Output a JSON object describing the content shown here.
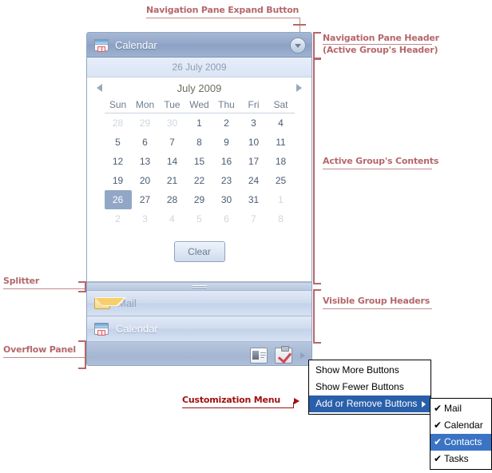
{
  "annotations": {
    "nav_expand_button": "Navigation Pane Expand Button",
    "nav_pane_header_line1": "Navigation Pane Header",
    "nav_pane_header_line2": "(Active Group's Header)",
    "active_group_contents": "Active Group's Contents",
    "visible_group_headers": "Visible Group Headers",
    "splitter": "Splitter",
    "overflow_panel": "Overflow Panel",
    "customization_menu": "Customization Menu",
    "accent_color": "#b5676b",
    "accent_color_dark": "#a01010"
  },
  "navpane": {
    "header": {
      "title": "Calendar",
      "icon": "calendar-icon",
      "expand_icon": "chevron-down-icon"
    },
    "calendar": {
      "selected_date_label": "26 July 2009",
      "month_label": "July 2009",
      "prev_icon": "triangle-left-icon",
      "next_icon": "triangle-right-icon",
      "weekday_headers": [
        "Sun",
        "Mon",
        "Tue",
        "Wed",
        "Thu",
        "Fri",
        "Sat"
      ],
      "weeks": [
        [
          {
            "d": "28",
            "s": "out"
          },
          {
            "d": "29",
            "s": "out"
          },
          {
            "d": "30",
            "s": "out"
          },
          {
            "d": "1",
            "s": ""
          },
          {
            "d": "2",
            "s": ""
          },
          {
            "d": "3",
            "s": ""
          },
          {
            "d": "4",
            "s": ""
          }
        ],
        [
          {
            "d": "5",
            "s": ""
          },
          {
            "d": "6",
            "s": ""
          },
          {
            "d": "7",
            "s": ""
          },
          {
            "d": "8",
            "s": ""
          },
          {
            "d": "9",
            "s": ""
          },
          {
            "d": "10",
            "s": ""
          },
          {
            "d": "11",
            "s": ""
          }
        ],
        [
          {
            "d": "12",
            "s": ""
          },
          {
            "d": "13",
            "s": ""
          },
          {
            "d": "14",
            "s": ""
          },
          {
            "d": "15",
            "s": ""
          },
          {
            "d": "16",
            "s": ""
          },
          {
            "d": "17",
            "s": ""
          },
          {
            "d": "18",
            "s": ""
          }
        ],
        [
          {
            "d": "19",
            "s": ""
          },
          {
            "d": "20",
            "s": ""
          },
          {
            "d": "21",
            "s": ""
          },
          {
            "d": "22",
            "s": ""
          },
          {
            "d": "23",
            "s": ""
          },
          {
            "d": "24",
            "s": ""
          },
          {
            "d": "25",
            "s": ""
          }
        ],
        [
          {
            "d": "26",
            "s": "sel"
          },
          {
            "d": "27",
            "s": ""
          },
          {
            "d": "28",
            "s": ""
          },
          {
            "d": "29",
            "s": ""
          },
          {
            "d": "30",
            "s": ""
          },
          {
            "d": "31",
            "s": ""
          },
          {
            "d": "1",
            "s": "out"
          }
        ],
        [
          {
            "d": "2",
            "s": "out"
          },
          {
            "d": "3",
            "s": "out"
          },
          {
            "d": "4",
            "s": "out"
          },
          {
            "d": "5",
            "s": "out"
          },
          {
            "d": "6",
            "s": "out"
          },
          {
            "d": "7",
            "s": "out"
          },
          {
            "d": "8",
            "s": "out"
          }
        ]
      ],
      "clear_label": "Clear"
    },
    "splitter_icon": "grip-handle-icon",
    "group_headers": [
      {
        "label": "Mail",
        "icon": "mail-icon",
        "active": false
      },
      {
        "label": "Calendar",
        "icon": "calendar-icon",
        "active": true
      }
    ],
    "overflow": {
      "buttons": [
        {
          "name": "contacts-icon",
          "title": "Contacts"
        },
        {
          "name": "tasks-icon",
          "title": "Tasks"
        }
      ],
      "arrow_icon": "triangle-right-icon"
    }
  },
  "customization_menu": {
    "items": [
      {
        "label": "Show More Buttons",
        "selected": false,
        "has_submenu": false
      },
      {
        "label": "Show Fewer Buttons",
        "selected": false,
        "has_submenu": false
      },
      {
        "label": "Add or Remove Buttons",
        "selected": true,
        "has_submenu": true
      }
    ],
    "submenu": {
      "items": [
        {
          "label": "Mail",
          "checked": true,
          "selected": false
        },
        {
          "label": "Calendar",
          "checked": true,
          "selected": false
        },
        {
          "label": "Contacts",
          "checked": true,
          "selected": true
        },
        {
          "label": "Tasks",
          "checked": true,
          "selected": false
        }
      ],
      "check_glyph": "✔"
    }
  }
}
